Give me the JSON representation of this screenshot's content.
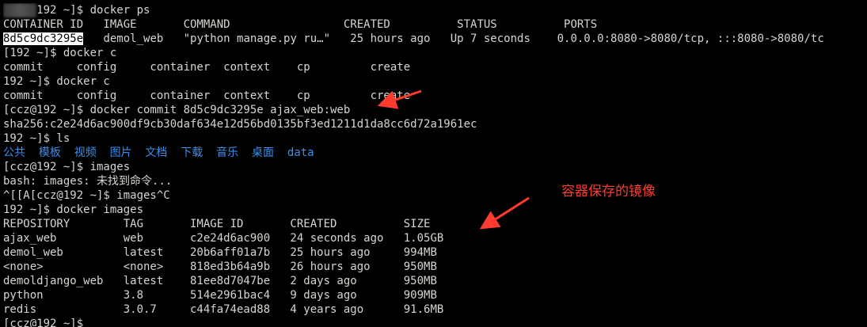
{
  "colors": {
    "background": "#000000",
    "text": "#d3d7cf",
    "directory": "#3b8eea",
    "highlight_bg": "#ffffff",
    "annotation": "#ff3b30"
  },
  "terminal": {
    "lines": [
      {
        "segments": [
          {
            "text": "192 ~]$ docker ps",
            "style": "blur-prefix"
          }
        ]
      },
      {
        "segments": [
          {
            "text": "CONTAINER ID   IMAGE       COMMAND                 CREATED          STATUS          PORTS"
          }
        ]
      },
      {
        "segments": [
          {
            "text": "8d5c9dc3295e",
            "style": "hl"
          },
          {
            "text": "   demol_web   \"python manage.py ru…\"   25 hours ago   Up 7 seconds    0.0.0.0:8080->8080/tcp, :::8080->8080/tc"
          }
        ]
      },
      {
        "segments": [
          {
            "text": "[",
            "style": "plain"
          },
          {
            "text": "     ",
            "style": "blur"
          },
          {
            "text": "192 ~]$ docker c"
          }
        ]
      },
      {
        "segments": [
          {
            "text": "commit     config     container  context    cp         create"
          }
        ]
      },
      {
        "segments": [
          {
            "text": "     ",
            "style": "blur"
          },
          {
            "text": "192 ~]$ docker c"
          }
        ]
      },
      {
        "segments": [
          {
            "text": "commit     config     container  context    cp         create"
          }
        ]
      },
      {
        "segments": [
          {
            "text": "[ccz@192 ~]$ docker commit 8d5c9dc3295e ajax_web:web"
          }
        ]
      },
      {
        "segments": [
          {
            "text": "sha256:c2e24d6ac900df9cb30daf634e12d56bd0135bf3ed1211d1da8cc6d72a1961ec"
          }
        ]
      },
      {
        "segments": [
          {
            "text": "     ",
            "style": "blur"
          },
          {
            "text": "192 ~]$ ls"
          }
        ]
      },
      {
        "segments": [
          {
            "text": "公共  模板  视频  图片  文档  下载  音乐  桌面  data",
            "style": "dir"
          }
        ]
      },
      {
        "segments": [
          {
            "text": "[ccz@192 ~]$ images"
          }
        ]
      },
      {
        "segments": [
          {
            "text": "bash: images: 未找到命令..."
          }
        ]
      },
      {
        "segments": [
          {
            "text": "^[[A[ccz@192 ~]$ images^C"
          }
        ]
      },
      {
        "segments": [
          {
            "text": "     ",
            "style": "blur"
          },
          {
            "text": "192 ~]$ docker images"
          }
        ]
      },
      {
        "segments": [
          {
            "text": "REPOSITORY        TAG       IMAGE ID       CREATED          SIZE"
          }
        ]
      },
      {
        "segments": [
          {
            "text": "ajax_web          web       c2e24d6ac900   24 seconds ago   1.05GB"
          }
        ]
      },
      {
        "segments": [
          {
            "text": "demol_web         latest    20b6aff01a7b   25 hours ago     994MB"
          }
        ]
      },
      {
        "segments": [
          {
            "text": "<none>            <none>    818ed3b64a9b   26 hours ago     950MB"
          }
        ]
      },
      {
        "segments": [
          {
            "text": "demoldjango_web   latest    81ee8d7047be   2 days ago       950MB"
          }
        ]
      },
      {
        "segments": [
          {
            "text": "python            3.8       514e2961bac4   9 days ago       909MB"
          }
        ]
      },
      {
        "segments": [
          {
            "text": "redis             3.0.7     c44fa74ead88   4 years ago      91.6MB"
          }
        ]
      },
      {
        "segments": [
          {
            "text": "[ccz@192 ~]$"
          }
        ]
      }
    ]
  },
  "annotation": {
    "label": "容器保存的镜像"
  }
}
